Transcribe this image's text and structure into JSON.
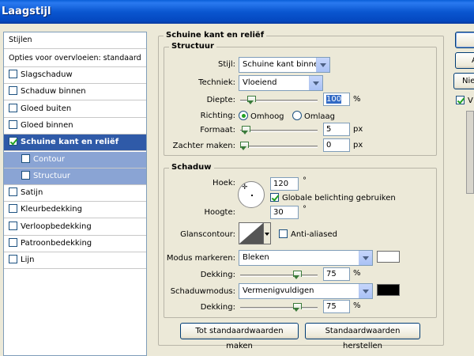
{
  "window": {
    "title": "Laagstijl"
  },
  "sidebar": {
    "header": "Stijlen",
    "blend_options": "Opties voor overvloeien: standaard",
    "items": [
      {
        "label": "Slagschaduw",
        "checked": false
      },
      {
        "label": "Schaduw binnen",
        "checked": false
      },
      {
        "label": "Gloed buiten",
        "checked": false
      },
      {
        "label": "Gloed binnen",
        "checked": false
      },
      {
        "label": "Schuine kant en reliëf",
        "checked": true,
        "selected": true
      },
      {
        "label": "Contour",
        "checked": false,
        "sub": true
      },
      {
        "label": "Structuur",
        "checked": false,
        "sub": true
      },
      {
        "label": "Satijn",
        "checked": false
      },
      {
        "label": "Kleurbedekking",
        "checked": false
      },
      {
        "label": "Verloopbedekking",
        "checked": false
      },
      {
        "label": "Patroonbedekking",
        "checked": false
      },
      {
        "label": "Lijn",
        "checked": false
      }
    ]
  },
  "bevel": {
    "title": "Schuine kant en reliëf",
    "structure": {
      "title": "Structuur",
      "style_label": "Stijl:",
      "style_value": "Schuine kant binnen",
      "technique_label": "Techniek:",
      "technique_value": "Vloeiend",
      "depth_label": "Diepte:",
      "depth_value": "100",
      "depth_unit": "%",
      "depth_fraction": 0.1,
      "direction_label": "Richting:",
      "direction_up": "Omhoog",
      "direction_down": "Omlaag",
      "size_label": "Formaat:",
      "size_value": "5",
      "size_unit": "px",
      "size_fraction": 0.02,
      "soften_label": "Zachter maken:",
      "soften_value": "0",
      "soften_unit": "px",
      "soften_fraction": 0.0
    },
    "shading": {
      "title": "Schaduw",
      "angle_label": "Hoek:",
      "angle_value": "120",
      "angle_unit": "°",
      "global_light_label": "Globale belichting gebruiken",
      "global_light_checked": true,
      "altitude_label": "Hoogte:",
      "altitude_value": "30",
      "altitude_unit": "°",
      "gloss_label": "Glanscontour:",
      "anti_aliased_label": "Anti-aliased",
      "anti_aliased_checked": false,
      "highlight_mode_label": "Modus markeren:",
      "highlight_mode_value": "Bleken",
      "highlight_color": "#ffffff",
      "highlight_opacity_label": "Dekking:",
      "highlight_opacity_value": "75",
      "highlight_opacity_unit": "%",
      "highlight_opacity_fraction": 0.75,
      "shadow_mode_label": "Schaduwmodus:",
      "shadow_mode_value": "Vermenigvuldigen",
      "shadow_color": "#000000",
      "shadow_opacity_label": "Dekking:",
      "shadow_opacity_value": "75",
      "shadow_opacity_unit": "%",
      "shadow_opacity_fraction": 0.75
    },
    "make_default_label": "Tot standaardwaarden maken",
    "reset_default_label": "Standaardwaarden herstellen"
  },
  "right_buttons": {
    "btn2_label": "A",
    "btn3_label": "Nie",
    "preview_label": "V",
    "preview_checked": true
  },
  "colors": {
    "selected": "#2f5aa8",
    "sub_selected": "#8aa4d4",
    "title_bar": "#0a56d0"
  }
}
